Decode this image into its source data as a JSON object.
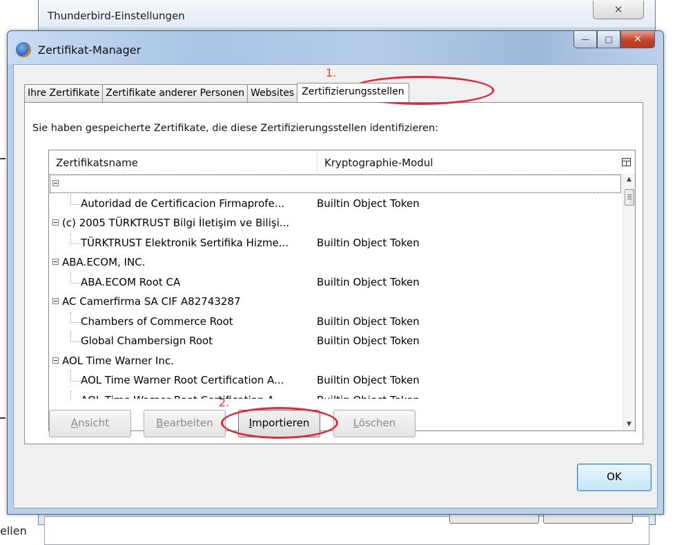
{
  "background_window": {
    "title": "Thunderbird-Einstellungen",
    "stray_text": "ellen",
    "close_glyph": "✕"
  },
  "dialog": {
    "title": "Zertifikat-Manager",
    "controls": {
      "minimize": "—",
      "maximize": "□",
      "close": "✕"
    }
  },
  "tabs": [
    {
      "label": "Ihre Zertifikate",
      "active": false
    },
    {
      "label": "Zertifikate anderer Personen",
      "active": false
    },
    {
      "label": "Websites",
      "active": false
    },
    {
      "label": "Zertifizierungsstellen",
      "active": true
    }
  ],
  "intro_text": "Sie haben gespeicherte Zertifikate, die diese Zertifizierungsstellen identifizieren:",
  "tree": {
    "columns": [
      "Zertifikatsname",
      "Kryptographie-Modul"
    ],
    "rows": [
      {
        "type": "group",
        "name": "",
        "module": ""
      },
      {
        "type": "child",
        "name": "Autoridad de Certificacion Firmaprofe...",
        "module": "Builtin Object Token"
      },
      {
        "type": "group",
        "name": "(c) 2005 TÜRKTRUST Bilgi İletişim ve Bilişi...",
        "module": ""
      },
      {
        "type": "child",
        "name": "TÜRKTRUST Elektronik Sertifika Hizme...",
        "module": "Builtin Object Token"
      },
      {
        "type": "group",
        "name": "ABA.ECOM, INC.",
        "module": ""
      },
      {
        "type": "child",
        "name": "ABA.ECOM Root CA",
        "module": "Builtin Object Token"
      },
      {
        "type": "group",
        "name": "AC Camerfirma SA CIF A82743287",
        "module": ""
      },
      {
        "type": "child",
        "name": "Chambers of Commerce Root",
        "module": "Builtin Object Token"
      },
      {
        "type": "child",
        "name": "Global Chambersign Root",
        "module": "Builtin Object Token"
      },
      {
        "type": "group",
        "name": "AOL Time Warner Inc.",
        "module": ""
      },
      {
        "type": "child",
        "name": "AOL Time Warner Root Certification A...",
        "module": "Builtin Object Token"
      },
      {
        "type": "child",
        "name": "AOL Time Warner Root Certification A...",
        "module": "Builtin Object Token"
      }
    ],
    "scroll_up": "▲",
    "scroll_down": "▼"
  },
  "buttons": {
    "view": {
      "accel": "A",
      "rest": "nsicht",
      "enabled": false
    },
    "edit": {
      "accel": "B",
      "rest": "earbeiten",
      "enabled": false
    },
    "import": {
      "accel": "I",
      "rest": "mportieren",
      "enabled": true
    },
    "delete": {
      "accel": "L",
      "rest": "öschen",
      "enabled": false
    },
    "ok": "OK"
  },
  "annotations": {
    "step1": "1.",
    "step2": "2.",
    "color": "#e0293a"
  }
}
